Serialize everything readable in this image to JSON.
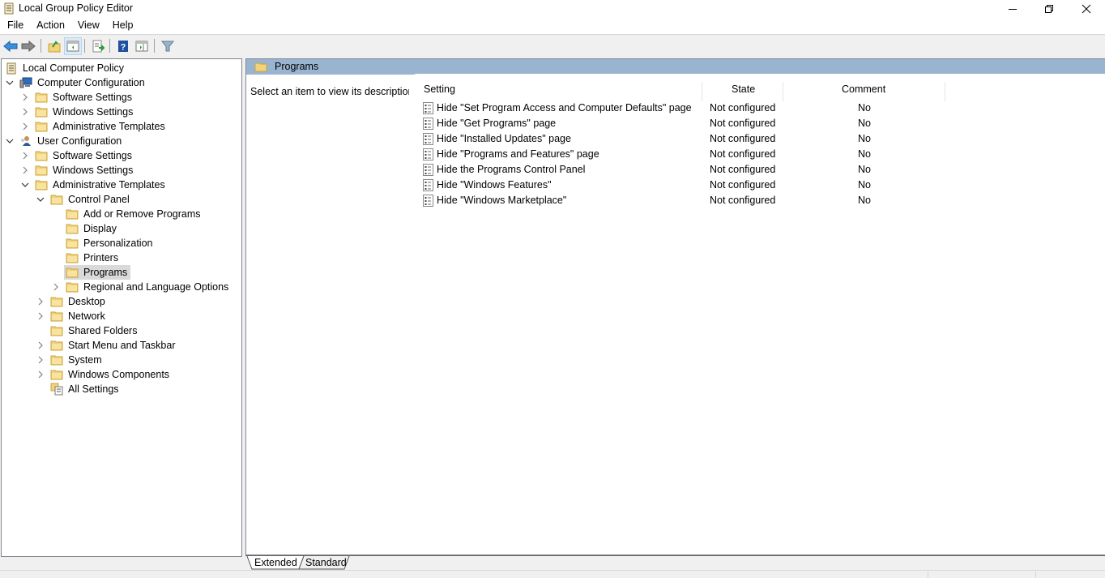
{
  "window": {
    "title": "Local Group Policy Editor",
    "controls": {
      "minimize": "minimize",
      "restore": "restore",
      "close": "close"
    }
  },
  "menu": {
    "items": [
      {
        "label": "File"
      },
      {
        "label": "Action"
      },
      {
        "label": "View"
      },
      {
        "label": "Help"
      }
    ]
  },
  "toolbar": {
    "buttons": [
      {
        "name": "back",
        "icon": "back-arrow-icon"
      },
      {
        "name": "forward",
        "icon": "forward-arrow-icon"
      },
      {
        "name": "up-one-level",
        "icon": "folder-up-icon"
      },
      {
        "name": "show-hide-console-tree",
        "icon": "console-tree-icon",
        "active": true
      },
      {
        "name": "export-list",
        "icon": "export-list-icon"
      },
      {
        "name": "help",
        "icon": "help-icon"
      },
      {
        "name": "show-hide-action-pane",
        "icon": "action-pane-icon"
      },
      {
        "name": "filter",
        "icon": "filter-icon"
      }
    ]
  },
  "tree": {
    "items": [
      {
        "label": "Local Computer Policy",
        "level": 0,
        "icon": "policy-scroll-icon",
        "expander": "none"
      },
      {
        "label": "Computer Configuration",
        "level": 1,
        "icon": "computer-icon",
        "expander": "expanded"
      },
      {
        "label": "Software Settings",
        "level": 2,
        "icon": "folder-icon",
        "expander": "collapsed"
      },
      {
        "label": "Windows Settings",
        "level": 2,
        "icon": "folder-icon",
        "expander": "collapsed"
      },
      {
        "label": "Administrative Templates",
        "level": 2,
        "icon": "folder-icon",
        "expander": "collapsed"
      },
      {
        "label": "User Configuration",
        "level": 1,
        "icon": "user-icon",
        "expander": "expanded"
      },
      {
        "label": "Software Settings",
        "level": 2,
        "icon": "folder-icon",
        "expander": "collapsed"
      },
      {
        "label": "Windows Settings",
        "level": 2,
        "icon": "folder-icon",
        "expander": "collapsed"
      },
      {
        "label": "Administrative Templates",
        "level": 2,
        "icon": "folder-icon",
        "expander": "expanded"
      },
      {
        "label": "Control Panel",
        "level": 3,
        "icon": "folder-icon",
        "expander": "expanded"
      },
      {
        "label": "Add or Remove Programs",
        "level": 4,
        "icon": "folder-icon",
        "expander": "none"
      },
      {
        "label": "Display",
        "level": 4,
        "icon": "folder-icon",
        "expander": "none"
      },
      {
        "label": "Personalization",
        "level": 4,
        "icon": "folder-icon",
        "expander": "none"
      },
      {
        "label": "Printers",
        "level": 4,
        "icon": "folder-icon",
        "expander": "none"
      },
      {
        "label": "Programs",
        "level": 4,
        "icon": "folder-icon",
        "expander": "none",
        "selected": true
      },
      {
        "label": "Regional and Language Options",
        "level": 4,
        "icon": "folder-icon",
        "expander": "collapsed"
      },
      {
        "label": "Desktop",
        "level": 3,
        "icon": "folder-icon",
        "expander": "collapsed"
      },
      {
        "label": "Network",
        "level": 3,
        "icon": "folder-icon",
        "expander": "collapsed"
      },
      {
        "label": "Shared Folders",
        "level": 3,
        "icon": "folder-icon",
        "expander": "none"
      },
      {
        "label": "Start Menu and Taskbar",
        "level": 3,
        "icon": "folder-icon",
        "expander": "collapsed"
      },
      {
        "label": "System",
        "level": 3,
        "icon": "folder-icon",
        "expander": "collapsed"
      },
      {
        "label": "Windows Components",
        "level": 3,
        "icon": "folder-icon",
        "expander": "collapsed"
      },
      {
        "label": "All Settings",
        "level": 3,
        "icon": "all-settings-icon",
        "expander": "none"
      }
    ]
  },
  "details": {
    "header_title": "Programs",
    "description": "Select an item to view its description.",
    "columns": {
      "setting": "Setting",
      "state": "State",
      "comment": "Comment"
    },
    "rows": [
      {
        "setting": "Hide \"Set Program Access and Computer Defaults\" page",
        "state": "Not configured",
        "comment": "No"
      },
      {
        "setting": "Hide \"Get Programs\" page",
        "state": "Not configured",
        "comment": "No"
      },
      {
        "setting": "Hide \"Installed Updates\" page",
        "state": "Not configured",
        "comment": "No"
      },
      {
        "setting": "Hide \"Programs and Features\" page",
        "state": "Not configured",
        "comment": "No"
      },
      {
        "setting": "Hide the Programs Control Panel",
        "state": "Not configured",
        "comment": "No"
      },
      {
        "setting": "Hide \"Windows Features\"",
        "state": "Not configured",
        "comment": "No"
      },
      {
        "setting": "Hide \"Windows Marketplace\"",
        "state": "Not configured",
        "comment": "No"
      }
    ]
  },
  "tabs": [
    {
      "label": "Extended",
      "active": true
    },
    {
      "label": "Standard",
      "active": false
    }
  ],
  "colors": {
    "header_bar": "#99b4d1",
    "selected_item": "#d9d9d9",
    "folder": "#f2d27a"
  }
}
